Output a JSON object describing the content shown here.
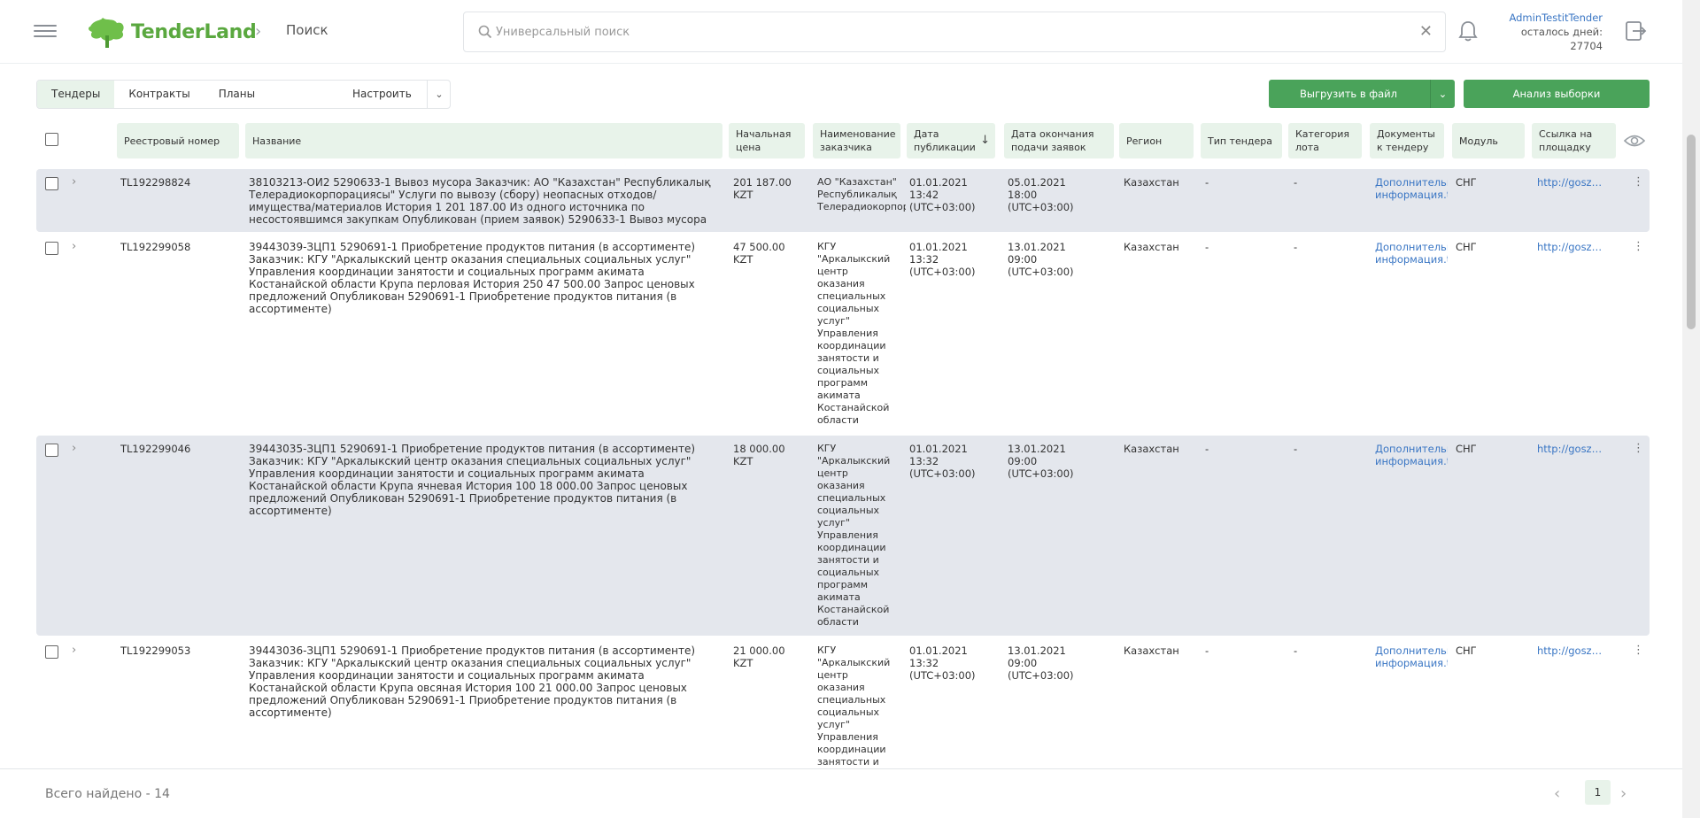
{
  "header": {
    "logo_text": "TenderLand",
    "breadcrumb": "Поиск",
    "search_placeholder": "Универсальный поиск",
    "user_name": "AdminTestitTender",
    "days_label": "осталось дней:",
    "days_value": "27704"
  },
  "toolbar": {
    "tabs": [
      "Тендеры",
      "Контракты",
      "Планы"
    ],
    "configure_label": "Настроить",
    "export_label": "Выгрузить в файл",
    "analyze_label": "Анализ выборки"
  },
  "columns": {
    "reg": "Реестровый номер",
    "name": "Название",
    "price": "Начальная цена",
    "customer": "Наименование заказчика",
    "pub": "Дата публикации",
    "end": "Дата окончания подачи заявок",
    "region": "Регион",
    "type": "Тип тендера",
    "cat": "Категория лота",
    "docs": "Документы к тендеру",
    "module": "Модуль",
    "link": "Ссылка на площадку"
  },
  "rows": [
    {
      "reg": "TL192298824",
      "name": "38103213-ОИ2 5290633-1 Вывоз мусора Заказчик: АО \"Казахстан\" Республикалық Телерадиокорпорациясы\" Услуги по вывозу (сбору) неопасных отходов/имущества/материалов История 1 201 187.00 Из одного источника по несостоявшимся закупкам Опубликован (прием заявок) 5290633-1 Вывоз мусора",
      "price": "201 187.00 KZT",
      "customer": "АО \"Казахстан\" Республикалық Телерадиокорпор",
      "pub": "01.01.2021 13:42 (UTC+03:00)",
      "end": "05.01.2021 18:00 (UTC+03:00)",
      "region": "Казахстан",
      "type": "-",
      "cat": "-",
      "docs": "Дополнительная информация.txt",
      "module": "СНГ",
      "link": "http://goszakup.gov.kz"
    },
    {
      "reg": "TL192299058",
      "name": "39443039-ЗЦП1 5290691-1 Приобретение продуктов питания (в ассортименте) Заказчик: КГУ \"Аркалыкский центр оказания специальных социальных услуг\" Управления координации занятости и социальных программ акимата Костанайской области Крупа перловая История 250 47 500.00 Запрос ценовых предложений Опубликован 5290691-1 Приобретение продуктов питания (в ассортименте)",
      "price": "47 500.00 KZT",
      "customer": "КГУ \"Аркалыкский центр оказания специальных социальных услуг\" Управления координации занятости и социальных программ акимата Костанайской области",
      "pub": "01.01.2021 13:32 (UTC+03:00)",
      "end": "13.01.2021 09:00 (UTC+03:00)",
      "region": "Казахстан",
      "type": "-",
      "cat": "-",
      "docs": "Дополнительная информация.txt",
      "module": "СНГ",
      "link": "http://goszakup.gov.kz"
    },
    {
      "reg": "TL192299046",
      "name": "39443035-ЗЦП1 5290691-1 Приобретение продуктов питания (в ассортименте) Заказчик: КГУ \"Аркалыкский центр оказания специальных социальных услуг\" Управления координации занятости и социальных программ акимата Костанайской области Крупа ячневая История 100 18 000.00 Запрос ценовых предложений Опубликован 5290691-1 Приобретение продуктов питания (в ассортименте)",
      "price": "18 000.00 KZT",
      "customer": "КГУ \"Аркалыкский центр оказания специальных социальных услуг\" Управления координации занятости и социальных программ акимата Костанайской области",
      "pub": "01.01.2021 13:32 (UTC+03:00)",
      "end": "13.01.2021 09:00 (UTC+03:00)",
      "region": "Казахстан",
      "type": "-",
      "cat": "-",
      "docs": "Дополнительная информация.txt",
      "module": "СНГ",
      "link": "http://goszakup.gov.kz"
    },
    {
      "reg": "TL192299053",
      "name": "39443036-ЗЦП1 5290691-1 Приобретение продуктов питания (в ассортименте) Заказчик: КГУ \"Аркалыкский центр оказания специальных социальных услуг\" Управления координации занятости и социальных программ акимата Костанайской области Крупа овсяная История 100 21 000.00 Запрос ценовых предложений Опубликован 5290691-1 Приобретение продуктов питания (в ассортименте)",
      "price": "21 000.00 KZT",
      "customer": "КГУ \"Аркалыкский центр оказания специальных социальных услуг\" Управления координации занятости и социальных программ",
      "pub": "01.01.2021 13:32 (UTC+03:00)",
      "end": "13.01.2021 09:00 (UTC+03:00)",
      "region": "Казахстан",
      "type": "-",
      "cat": "-",
      "docs": "Дополнительная информация.txt",
      "module": "СНГ",
      "link": "http://goszakup.gov.kz"
    }
  ],
  "footer": {
    "total": "Всего найдено - 14",
    "page": "1"
  },
  "colors": {
    "brand_green": "#5aa83f",
    "button_green": "#4aa35a",
    "header_bg": "#e8f3ea",
    "link_blue": "#3a76c4",
    "row_alt": "#e4e7ed"
  },
  "icons": [
    "menu-icon",
    "search-icon",
    "close-icon",
    "bell-icon",
    "logout-icon",
    "chevron-down-icon",
    "sort-down-icon",
    "eye-icon",
    "chevron-right-icon",
    "kebab-icon",
    "chevron-left-icon"
  ]
}
